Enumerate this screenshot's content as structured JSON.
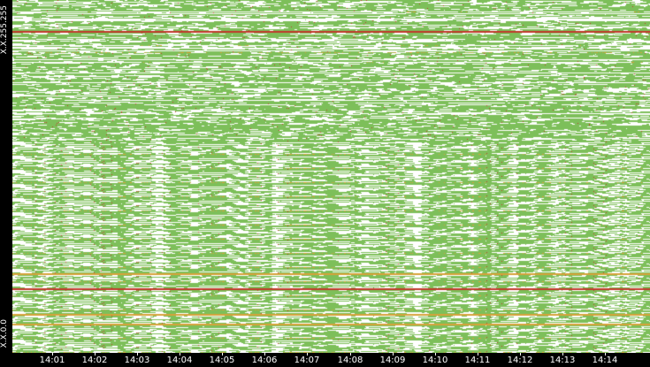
{
  "chart_data": {
    "type": "heatmap",
    "title": "",
    "xlabel": "",
    "ylabel": "",
    "y_tick_labels": [
      "X.X.255.255",
      "X.X.0.0"
    ],
    "x_tick_labels": [
      "14:01",
      "14:02",
      "14:03",
      "14:04",
      "14:05",
      "14:06",
      "14:07",
      "14:08",
      "14:09",
      "14:10",
      "14:11",
      "14:12",
      "14:13",
      "14:14"
    ],
    "x_range": [
      "14:00",
      "14:15"
    ],
    "y_range": [
      "X.X.0.0",
      "X.X.255.255"
    ],
    "colors": {
      "background": "#ffffff",
      "low": "#7dbf5a",
      "medium": "#d6a23a",
      "high": "#c0392b",
      "axis_bg": "#000000",
      "axis_text": "#ffffff"
    },
    "grid": false,
    "legend": "none"
  }
}
